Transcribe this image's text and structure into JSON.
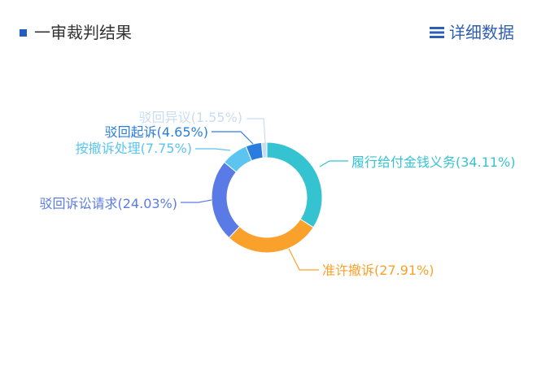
{
  "header": {
    "title": "一审裁判结果",
    "details_label": "详细数据",
    "details_icon": "menu-icon",
    "accent": "#1f5fbf"
  },
  "chart_data": {
    "type": "pie",
    "title": "",
    "series": [
      {
        "name": "履行给付金钱义务",
        "label": "履行给付金钱义务(34.11%)",
        "value": 34.11,
        "color": "#36c3d1"
      },
      {
        "name": "准许撤诉",
        "label": "准许撤诉(27.91%)",
        "value": 27.91,
        "color": "#f9a12b"
      },
      {
        "name": "驳回诉讼请求",
        "label": "驳回诉讼请求(24.03%)",
        "value": 24.03,
        "color": "#5a7be6"
      },
      {
        "name": "按撤诉处理",
        "label": "按撤诉处理(7.75%)",
        "value": 7.75,
        "color": "#5bc4f0"
      },
      {
        "name": "驳回起诉",
        "label": "驳回起诉(4.65%)",
        "value": 4.65,
        "color": "#2a7de0"
      },
      {
        "name": "驳回异议",
        "label": "驳回异议(1.55%)",
        "value": 1.55,
        "color": "#c9dcf2"
      }
    ]
  }
}
